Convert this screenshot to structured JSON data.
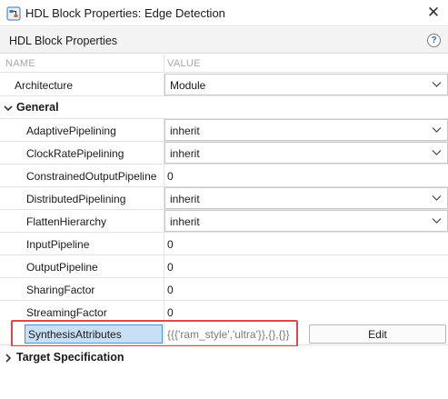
{
  "window": {
    "title": "HDL Block Properties: Edge Detection",
    "close_glyph": "✕"
  },
  "header": {
    "title": "HDL Block Properties",
    "help_glyph": "?"
  },
  "columns": {
    "name": "NAME",
    "value": "VALUE"
  },
  "architecture": {
    "label": "Architecture",
    "value": "Module"
  },
  "general": {
    "label": "General",
    "expanded": true,
    "properties": [
      {
        "label": "AdaptivePipelining",
        "kind": "dropdown",
        "value": "inherit"
      },
      {
        "label": "ClockRatePipelining",
        "kind": "dropdown",
        "value": "inherit"
      },
      {
        "label": "ConstrainedOutputPipeline",
        "kind": "text",
        "value": "0"
      },
      {
        "label": "DistributedPipelining",
        "kind": "dropdown",
        "value": "inherit"
      },
      {
        "label": "FlattenHierarchy",
        "kind": "dropdown",
        "value": "inherit"
      },
      {
        "label": "InputPipeline",
        "kind": "text",
        "value": "0"
      },
      {
        "label": "OutputPipeline",
        "kind": "text",
        "value": "0"
      },
      {
        "label": "SharingFactor",
        "kind": "text",
        "value": "0"
      },
      {
        "label": "StreamingFactor",
        "kind": "text",
        "value": "0"
      }
    ],
    "synthesis": {
      "label": "SynthesisAttributes",
      "value": "{{{'ram_style','ultra'}},{},{}}",
      "edit_label": "Edit"
    }
  },
  "target_spec": {
    "label": "Target Specification",
    "expanded": false
  },
  "colors": {
    "selection_fill": "#c8e0f6",
    "selection_border": "#4a8fd8",
    "annotation": "#e04848",
    "help_accent": "#2a6bb8"
  }
}
